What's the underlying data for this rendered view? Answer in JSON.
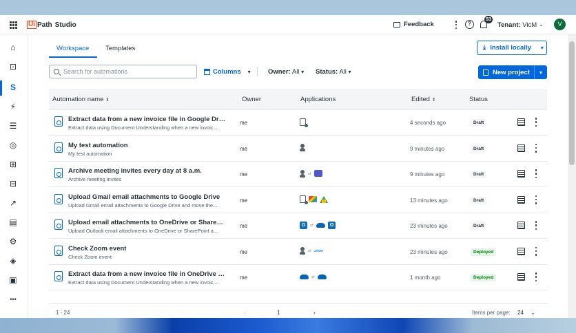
{
  "header": {
    "logo_box": "Ui",
    "logo_path": "Path",
    "product": "Studio",
    "feedback": "Feedback",
    "help": "?",
    "notifications": "53",
    "tenant_label": "Tenant:",
    "tenant_value": "VicM",
    "tenant_chev": "⌄",
    "avatar": "V"
  },
  "nav": {
    "icons": [
      "home-icon",
      "robot-icon",
      "studio-icon",
      "insights-icon",
      "academy-icon",
      "governance-icon",
      "apps-icon",
      "integration-icon",
      "analytics-icon",
      "marketplace-icon",
      "orchestrator-icon",
      "layers-icon",
      "settings-icon",
      "more-icon"
    ],
    "glyphs": [
      "⌂",
      "⊡",
      "S",
      "⚡",
      "☰",
      "◎",
      "⊞",
      "⊟",
      "↗",
      "▤",
      "⚙",
      "◈",
      "▣",
      "•••"
    ]
  },
  "tabs": [
    "Workspace",
    "Templates"
  ],
  "toolbar": {
    "install": "Install locally",
    "install_chev": "▾",
    "search_placeholder": "Search for automations",
    "columns": "Columns",
    "columns_chev": "▾",
    "owner_label": "Owner:",
    "owner_value": "All",
    "status_label": "Status:",
    "status_value": "All",
    "new_project": "New project",
    "new_project_chev": "▾"
  },
  "table": {
    "headers": [
      "Automation name",
      "Owner",
      "Applications",
      "Edited",
      "Status"
    ],
    "sort_glyph": "⇕",
    "rows": [
      {
        "title": "Extract data from a new invoice file in Google Drive ...",
        "desc": "Extract data using Document Understanding when a new invoic...",
        "owner": "me",
        "apps": [
          "clipboard-icon"
        ],
        "edited": "4 seconds ago",
        "status": "Draft"
      },
      {
        "title": "My test automation",
        "desc": "My test automation",
        "owner": "me",
        "apps": [
          "person-icon"
        ],
        "edited": "9 minutes ago",
        "status": "Draft"
      },
      {
        "title": "Archive meeting invites every day at 8 a.m.",
        "desc": "Archive meeting invites",
        "owner": "me",
        "apps": [
          "person-icon",
          "arrow",
          "teams-icon"
        ],
        "edited": "9 minutes ago",
        "status": "Draft"
      },
      {
        "title": "Upload Gmail email attachments to Google Drive",
        "desc": "Upload Gmail email attachments to Google Drive and move the...",
        "owner": "me",
        "apps": [
          "clipboard-icon",
          "gmail-icon",
          "gdrive-icon"
        ],
        "edited": "13 minutes ago",
        "status": "Draft"
      },
      {
        "title": "Upload email attachments to OneDrive or SharePoint",
        "desc": "Upload Outlook email attachments to OneDrive or SharePoint a...",
        "owner": "me",
        "apps": [
          "outlook-icon",
          "arrow",
          "onedrive-icon",
          "outlook-icon"
        ],
        "edited": "23 minutes ago",
        "status": "Draft"
      },
      {
        "title": "Check Zoom event",
        "desc": "Check Zoom event",
        "owner": "me",
        "apps": [
          "person-icon",
          "arrow",
          "zoom-icon"
        ],
        "edited": "23 minutes ago",
        "status": "Deployed"
      },
      {
        "title": "Extract data from a new invoice file in OneDrive and...",
        "desc": "Extract data using Document Understanding when a new invoic...",
        "owner": "me",
        "apps": [
          "onedrive-icon",
          "arrow",
          "onedrive-icon"
        ],
        "edited": "1 month ago",
        "status": "Deployed"
      }
    ]
  },
  "pagination": {
    "range": "1 - 24",
    "prev": "‹",
    "page": "1",
    "next": "›",
    "per_page_label": "Items per page:",
    "per_page": "24",
    "per_page_chev": "⌄"
  },
  "colors": {
    "accent": "#0067df",
    "brand": "#fa4616",
    "deployed": "#038108"
  }
}
